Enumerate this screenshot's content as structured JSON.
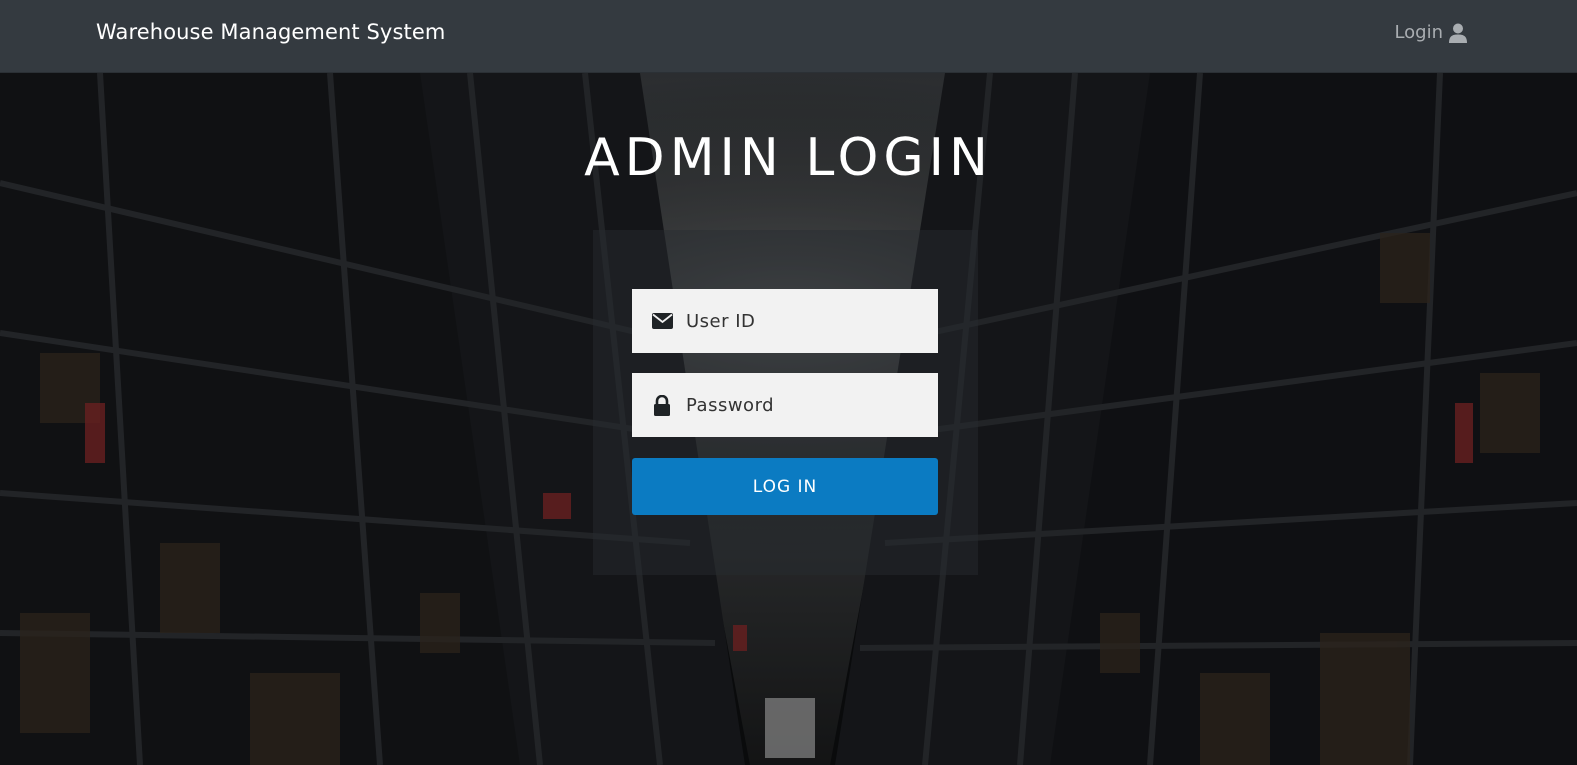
{
  "navbar": {
    "brand": "Warehouse Management System",
    "login_label": "Login",
    "background_color": "#343a40"
  },
  "main": {
    "title": "ADMIN LOGIN"
  },
  "form": {
    "user_placeholder": "User ID",
    "user_value": "",
    "user_icon": "envelope-icon",
    "password_placeholder": "Password",
    "password_value": "",
    "password_icon": "lock-icon",
    "submit_label": "LOG IN",
    "submit_color": "#0b7bc2"
  },
  "icons": {
    "nav_login_icon": "user-icon"
  }
}
